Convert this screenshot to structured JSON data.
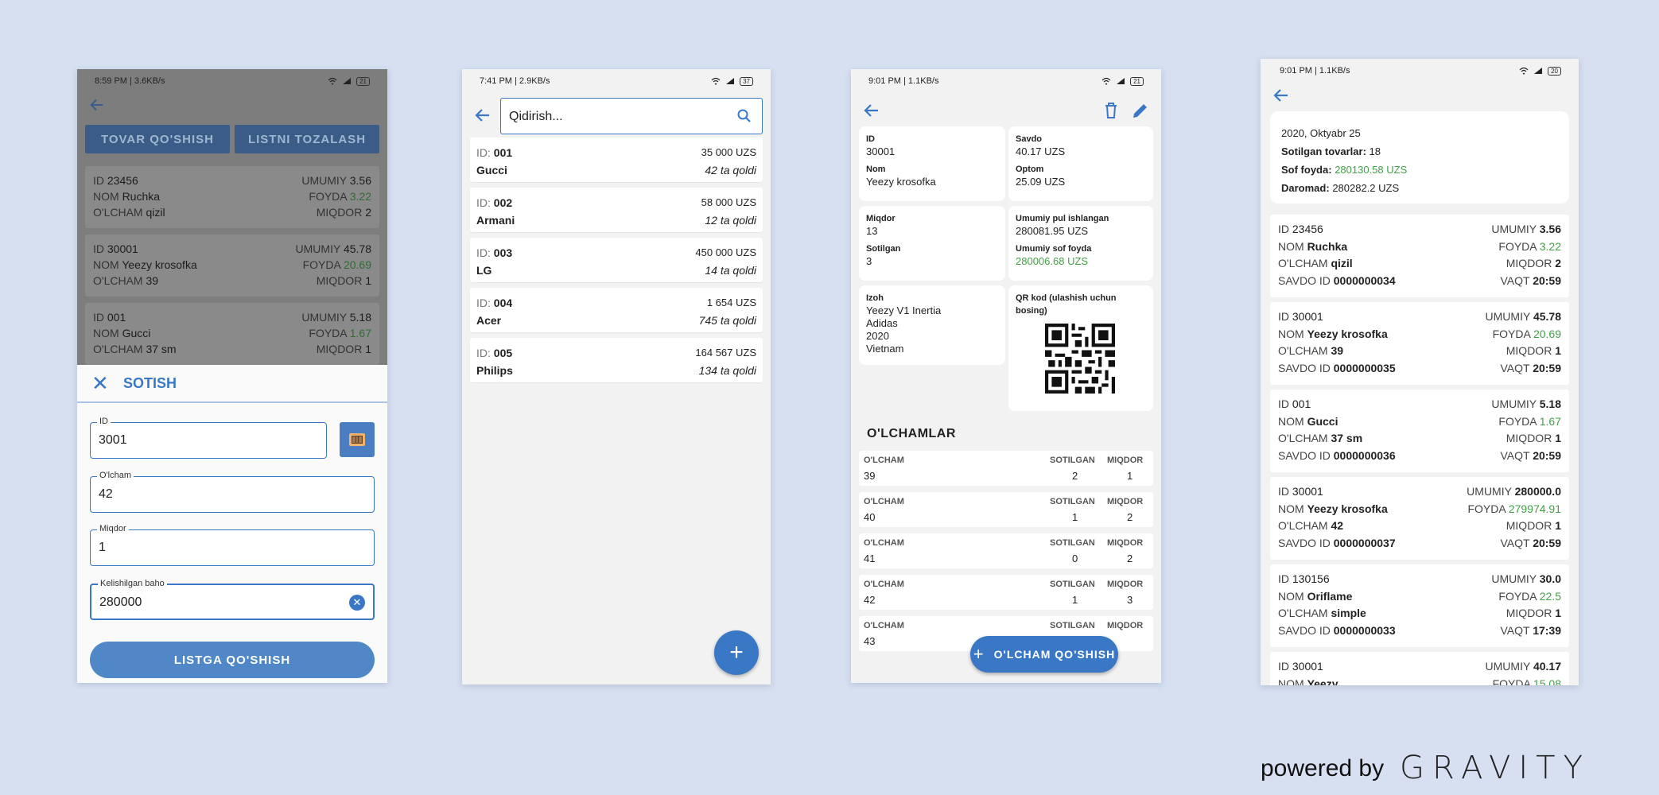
{
  "phone1": {
    "status": {
      "time": "8:59 PM | 3.6KB/s",
      "battery": "21"
    },
    "buttons": {
      "add_product": "TOVAR QO'SHISH",
      "clear_list": "LISTNI TOZALASH"
    },
    "items": [
      {
        "id_label": "ID",
        "id": "23456",
        "total_label": "UMUMIY",
        "total": "3.56",
        "name_label": "NOM",
        "name": "Ruchka",
        "profit_label": "FOYDA",
        "profit": "3.22",
        "size_label": "O'LCHAM",
        "size": "qizil",
        "qty_label": "MIQDOR",
        "qty": "2"
      },
      {
        "id_label": "ID",
        "id": "30001",
        "total_label": "UMUMIY",
        "total": "45.78",
        "name_label": "NOM",
        "name": "Yeezy krosofka",
        "profit_label": "FOYDA",
        "profit": "20.69",
        "size_label": "O'LCHAM",
        "size": "39",
        "qty_label": "MIQDOR",
        "qty": "1"
      },
      {
        "id_label": "ID",
        "id": "001",
        "total_label": "UMUMIY",
        "total": "5.18",
        "name_label": "NOM",
        "name": "Gucci",
        "profit_label": "FOYDA",
        "profit": "1.67",
        "size_label": "O'LCHAM",
        "size": "37 sm",
        "qty_label": "MIQDOR",
        "qty": "1"
      }
    ],
    "sheet": {
      "title": "SOTISH",
      "id_label": "ID",
      "id_value": "3001",
      "size_label": "O'lcham",
      "size_value": "42",
      "qty_label": "Miqdor",
      "qty_value": "1",
      "price_label": "Kelishilgan baho",
      "price_value": "280000",
      "submit": "LISTGA QO'SHISH"
    }
  },
  "phone2": {
    "status": {
      "time": "7:41 PM | 2.9KB/s",
      "battery": "37"
    },
    "search_placeholder": "Qidirish...",
    "products": [
      {
        "id_label": "ID:",
        "id": "001",
        "price": "35 000 UZS",
        "name": "Gucci",
        "left": "42 ta qoldi"
      },
      {
        "id_label": "ID:",
        "id": "002",
        "price": "58 000 UZS",
        "name": "Armani",
        "left": "12 ta qoldi"
      },
      {
        "id_label": "ID:",
        "id": "003",
        "price": "450 000 UZS",
        "name": "LG",
        "left": "14 ta qoldi"
      },
      {
        "id_label": "ID:",
        "id": "004",
        "price": "1 654 UZS",
        "name": "Acer",
        "left": "745 ta qoldi"
      },
      {
        "id_label": "ID:",
        "id": "005",
        "price": "164 567 UZS",
        "name": "Philips",
        "left": "134 ta qoldi"
      }
    ],
    "fab": "+"
  },
  "phone3": {
    "status": {
      "time": "9:01 PM | 1.1KB/s",
      "battery": "21"
    },
    "tiles": {
      "id_label": "ID",
      "id": "30001",
      "name_label": "Nom",
      "name": "Yeezy krosofka",
      "sale_label": "Savdo",
      "sale": "40.17 UZS",
      "wholesale_label": "Optom",
      "wholesale": "25.09 UZS",
      "qty_label": "Miqdor",
      "qty": "13",
      "sold_label": "Sotilgan",
      "sold": "3",
      "earned_label": "Umumiy pul ishlangan",
      "earned": "280081.95 UZS",
      "net_label": "Umumiy sof foyda",
      "net": "280006.68 UZS",
      "desc_label": "Izoh",
      "desc_lines": [
        "Yeezy V1 Inertia",
        "Adidas",
        "2020",
        "Vietnam"
      ],
      "qr_label": "QR kod (ulashish uchun bosing)"
    },
    "sizes_title": "O'LCHAMLAR",
    "size_header": {
      "size": "O'LCHAM",
      "sold": "SOTILGAN",
      "qty": "MIQDOR"
    },
    "sizes": [
      {
        "size": "39",
        "sold": "2",
        "qty": "1"
      },
      {
        "size": "40",
        "sold": "1",
        "qty": "2"
      },
      {
        "size": "41",
        "sold": "0",
        "qty": "2"
      },
      {
        "size": "42",
        "sold": "1",
        "qty": "3"
      },
      {
        "size": "43",
        "sold": "",
        "qty": ""
      }
    ],
    "add_size": "O'LCHAM QO'SHISH"
  },
  "phone4": {
    "status": {
      "time": "9:01 PM | 1.1KB/s",
      "battery": "20"
    },
    "summary": {
      "date": "2020, Oktyabr 25",
      "sold_label": "Sotilgan tovarlar:",
      "sold": "18",
      "net_label": "Sof foyda:",
      "net": "280130.58 UZS",
      "revenue_label": "Daromad:",
      "revenue": "280282.2 UZS"
    },
    "sales": [
      {
        "id": "23456",
        "total": "3.56",
        "name": "Ruchka",
        "profit": "3.22",
        "size": "qizil",
        "qty": "2",
        "sale_id": "0000000034",
        "time": "20:59"
      },
      {
        "id": "30001",
        "total": "45.78",
        "name": "Yeezy krosofka",
        "profit": "20.69",
        "size": "39",
        "qty": "1",
        "sale_id": "0000000035",
        "time": "20:59"
      },
      {
        "id": "001",
        "total": "5.18",
        "name": "Gucci",
        "profit": "1.67",
        "size": "37 sm",
        "qty": "1",
        "sale_id": "0000000036",
        "time": "20:59"
      },
      {
        "id": "30001",
        "total": "280000.0",
        "name": "Yeezy krosofka",
        "profit": "279974.91",
        "size": "42",
        "qty": "1",
        "sale_id": "0000000037",
        "time": "20:59"
      },
      {
        "id": "130156",
        "total": "30.0",
        "name": "Oriflame",
        "profit": "22.5",
        "size": "simple",
        "qty": "1",
        "sale_id": "0000000033",
        "time": "17:39"
      },
      {
        "id": "30001",
        "total": "40.17",
        "name": "Yeezy",
        "profit": "15.08",
        "size": "",
        "qty": "",
        "sale_id": "",
        "time": ""
      }
    ],
    "labels": {
      "id": "ID",
      "total": "UMUMIY",
      "name": "NOM",
      "profit": "FOYDA",
      "size": "O'LCHAM",
      "qty": "MIQDOR",
      "sale_id": "SAVDO ID",
      "time": "VAQT"
    }
  },
  "branding": {
    "powered": "powered by",
    "brand": "GRAVITY"
  },
  "colors": {
    "accent": "#3a78c6",
    "profit_green": "#43a047",
    "background": "#d6e0f1"
  }
}
